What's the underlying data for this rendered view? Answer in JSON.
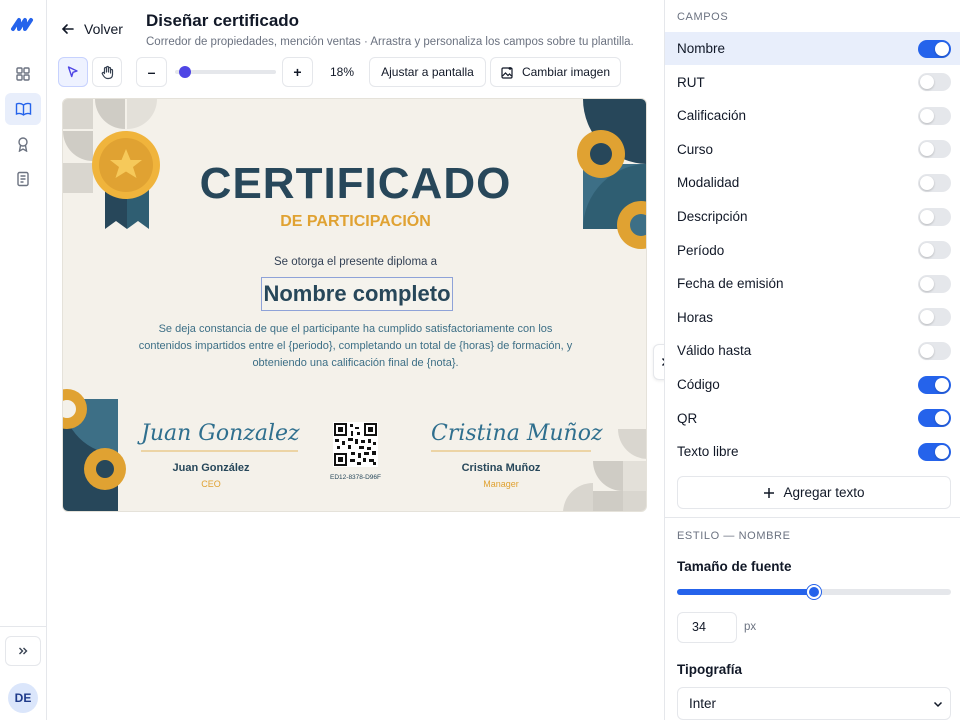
{
  "header": {
    "back_label": "Volver",
    "title": "Diseñar certificado",
    "subtitle": "Corredor de propiedades, mención ventas · Arrastra y personaliza los campos sobre tu plantilla."
  },
  "toolbar": {
    "select_tool_icon": "cursor-arrow-icon",
    "pan_tool_icon": "hand-icon",
    "zoom_out_label": "–",
    "zoom_in_label": "+",
    "zoom_value": "18%",
    "zoom_fraction": 0.18,
    "fit_label": "Ajustar a pantalla",
    "change_image_label": "Cambiar imagen"
  },
  "sidebar": {
    "items": [
      {
        "icon": "dashboard-grid-icon",
        "active": false
      },
      {
        "icon": "book-open-icon",
        "active": true
      },
      {
        "icon": "award-ribbon-icon",
        "active": false
      },
      {
        "icon": "document-icon",
        "active": false
      }
    ],
    "expand_icon": "double-chevron-right-icon",
    "avatar_initials": "DE"
  },
  "certificate": {
    "title": "CERTIFICADO",
    "subtitle": "DE PARTICIPACIÓN",
    "grant_text": "Se otorga el presente diploma a",
    "name_placeholder": "Nombre completo",
    "description": "Se deja constancia de que el participante ha cumplido satisfactoriamente con los contenidos impartidos entre el {periodo}, completando un total de {horas} de formación, y obteniendo una calificación final de {nota}.",
    "signer_left": {
      "signature": "Juan Gonzalez",
      "name": "Juan González",
      "role": "CEO"
    },
    "signer_right": {
      "signature": "Cristina Muñoz",
      "name": "Cristina Muñoz",
      "role": "Manager"
    },
    "code": "ED12-8378-D96F",
    "colors": {
      "navy": "#27475a",
      "gold": "#e0a232",
      "teal": "#3d6f86",
      "paper": "#f4f1ea"
    }
  },
  "panel": {
    "fields_heading": "CAMPOS",
    "fields": [
      {
        "label": "Nombre",
        "on": true,
        "active": true
      },
      {
        "label": "RUT",
        "on": false,
        "active": false
      },
      {
        "label": "Calificación",
        "on": false,
        "active": false
      },
      {
        "label": "Curso",
        "on": false,
        "active": false
      },
      {
        "label": "Modalidad",
        "on": false,
        "active": false
      },
      {
        "label": "Descripción",
        "on": false,
        "active": false
      },
      {
        "label": "Período",
        "on": false,
        "active": false
      },
      {
        "label": "Fecha de emisión",
        "on": false,
        "active": false
      },
      {
        "label": "Horas",
        "on": false,
        "active": false
      },
      {
        "label": "Válido hasta",
        "on": false,
        "active": false
      },
      {
        "label": "Código",
        "on": true,
        "active": false
      },
      {
        "label": "QR",
        "on": true,
        "active": false
      },
      {
        "label": "Texto libre",
        "on": true,
        "active": false
      }
    ],
    "add_text_label": "Agregar texto",
    "style_heading": "ESTILO — NOMBRE",
    "font_size_label": "Tamaño de fuente",
    "font_size_fraction": 0.5,
    "font_size_value": "34",
    "font_size_unit": "px",
    "typography_label": "Tipografía",
    "typography_value": "Inter"
  },
  "accent_color": "#2563eb"
}
